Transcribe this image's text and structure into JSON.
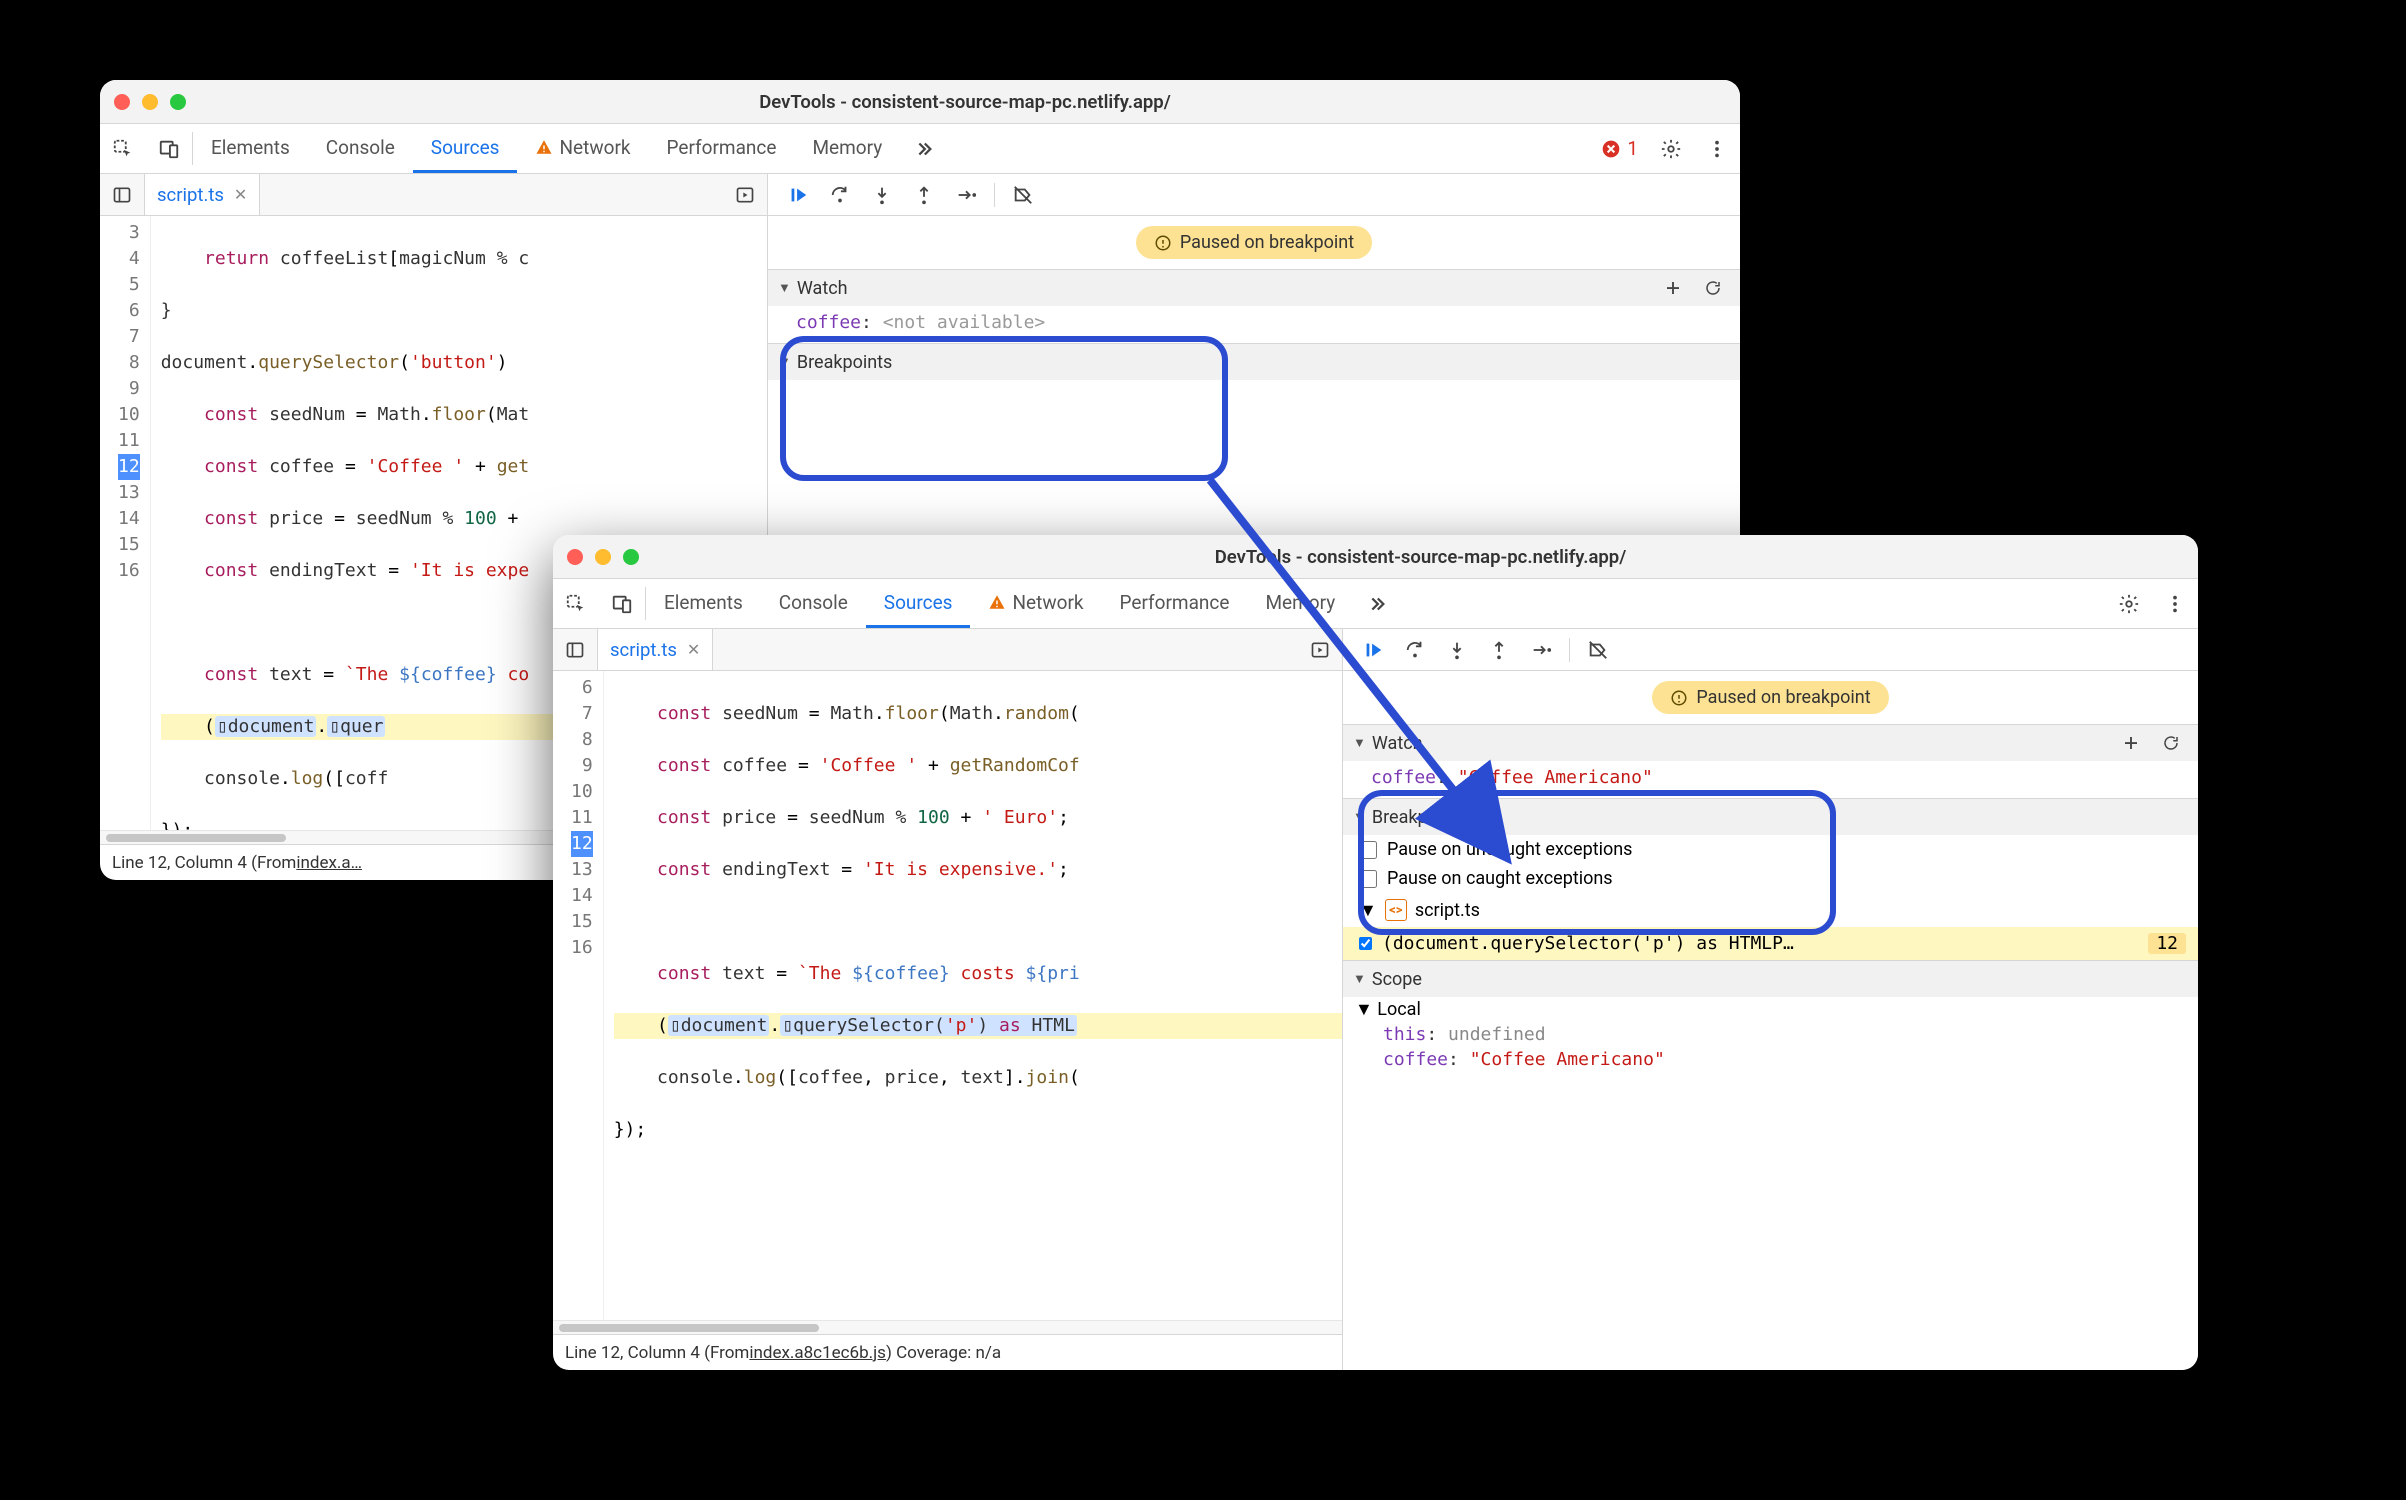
{
  "window1": {
    "title": "DevTools - consistent-source-map-pc.netlify.app/",
    "tabs": [
      "Elements",
      "Console",
      "Sources",
      "Network",
      "Performance",
      "Memory"
    ],
    "active_tab": "Sources",
    "error_count": "1",
    "filetab": "script.ts",
    "gutter": [
      "3",
      "4",
      "5",
      "6",
      "7",
      "8",
      "9",
      "10",
      "11",
      "12",
      "13",
      "14",
      "15",
      "16"
    ],
    "status_prefix": "Line 12, Column 4  (From ",
    "status_link": "index.a…",
    "debugger": {
      "paused_text": "Paused on breakpoint",
      "watch_label": "Watch",
      "watch_name": "coffee",
      "watch_value": "<not available>",
      "breakpoints_label": "Breakpoints"
    }
  },
  "window2": {
    "title": "DevTools - consistent-source-map-pc.netlify.app/",
    "tabs": [
      "Elements",
      "Console",
      "Sources",
      "Network",
      "Performance",
      "Memory"
    ],
    "active_tab": "Sources",
    "filetab": "script.ts",
    "gutter": [
      "6",
      "7",
      "8",
      "9",
      "10",
      "11",
      "12",
      "13",
      "14",
      "15",
      "16"
    ],
    "status_prefix": "Line 12, Column 4  (From ",
    "status_link": "index.a8c1ec6b.js",
    "status_suffix": ") Coverage: n/a",
    "debugger": {
      "paused_text": "Paused on breakpoint",
      "watch_label": "Watch",
      "watch_name": "coffee",
      "watch_value": "\"Coffee Americano\"",
      "breakpoints_label": "Breakpoints",
      "pause_uncaught": "Pause on uncaught exceptions",
      "pause_caught": "Pause on caught exceptions",
      "bp_file": "script.ts",
      "bp_text": "(document.querySelector('p') as HTMLP…",
      "bp_line": "12",
      "scope_label": "Scope",
      "local_label": "Local",
      "this_key": "this",
      "this_val": "undefined",
      "coffee_key": "coffee",
      "coffee_val": "\"Coffee Americano\""
    }
  }
}
